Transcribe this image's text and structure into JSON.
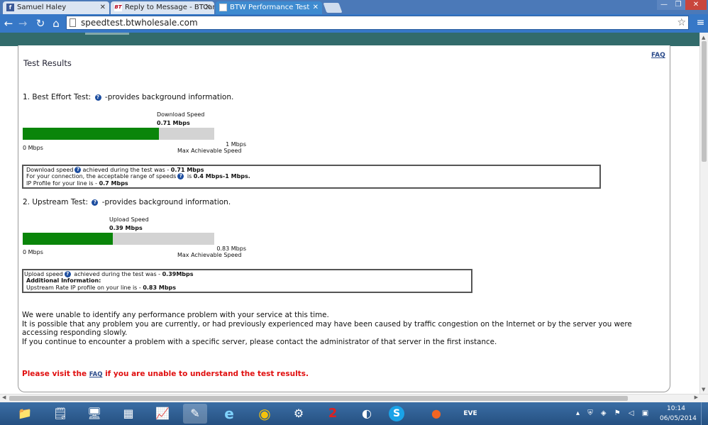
{
  "browser": {
    "tabs": [
      {
        "label": "Samuel Haley",
        "icon": "facebook-icon",
        "favicon_text": "f"
      },
      {
        "label": "Reply to Message - BTCar",
        "icon": "bt-icon",
        "favicon_text": "BT"
      },
      {
        "label": "BTW Performance Test",
        "icon": "page-icon",
        "favicon_text": ""
      }
    ],
    "close_glyph": "✕",
    "url": "speedtest.btwholesale.com",
    "window_controls": {
      "minimize": "—",
      "maximize": "❐",
      "close": "✕"
    }
  },
  "page": {
    "faq_link": "FAQ",
    "title": "Test Results",
    "best_effort": {
      "heading_prefix": "1. Best Effort Test:",
      "heading_suffix": "-provides background information.",
      "speed_label": "Download  Speed",
      "speed_value": "0.71 Mbps",
      "fill_fraction": 0.71,
      "min_label": "0 Mbps",
      "max_value": "1 Mbps",
      "max_label": "Max Achievable Speed",
      "info": {
        "line1_a": "Download speed",
        "line1_b": "achieved during the test was - ",
        "line1_val": "0.71 Mbps",
        "line2_a": "For your connection, the acceptable range of speeds",
        "line2_b": " is ",
        "line2_val": "0.4 Mbps-1 Mbps",
        "line2_end": ".",
        "line3_a": "IP Profile for your line is - ",
        "line3_val": "0.7 Mbps"
      }
    },
    "upstream": {
      "heading_prefix": "2. Upstream Test:",
      "heading_suffix": "-provides background information.",
      "speed_label": "Upload Speed",
      "speed_value": "0.39 Mbps",
      "fill_fraction": 0.47,
      "min_label": "0 Mbps",
      "max_value": "0.83 Mbps",
      "max_label": "Max Achievable Speed",
      "info": {
        "line1_a": "Upload speed",
        "line1_b": " achieved during the test was - ",
        "line1_val": "0.39Mbps",
        "line2": "Additional Information:",
        "line3_a": "Upstream Rate IP profile on your line is - ",
        "line3_val": "0.83 Mbps"
      }
    },
    "message": {
      "line1": "We were unable to identify any performance problem with your service at this time.",
      "line2": "It is possible that any problem you are currently, or had previously experienced may have been caused by traffic congestion on the Internet or by the server you were accessing responding slowly.",
      "line3": "If you continue to encounter a problem with a specific server, please contact the administrator of that server in the first instance."
    },
    "visit": {
      "prefix": "Please visit the ",
      "link": "FAQ",
      "suffix": " if you are unable to understand the test results."
    },
    "colors": {
      "fill": "#0a850a",
      "track": "#d3d3d3",
      "visit_text": "#e01010",
      "strip": "#326b6b"
    }
  },
  "taskbar": {
    "apps": [
      {
        "name": "file-explorer-icon",
        "glyph": "📁"
      },
      {
        "name": "notes-icon",
        "glyph": "🗒"
      },
      {
        "name": "control-panel-icon",
        "glyph": "🖥"
      },
      {
        "name": "calculator-icon",
        "glyph": "▦"
      },
      {
        "name": "monitor-app-icon",
        "glyph": "📈"
      },
      {
        "name": "writer-app-icon",
        "glyph": "✎"
      },
      {
        "name": "internet-explorer-icon",
        "glyph": "e"
      },
      {
        "name": "chrome-icon",
        "glyph": "◉"
      },
      {
        "name": "steam-icon",
        "glyph": "⚙"
      },
      {
        "name": "game-2-icon",
        "glyph": "2"
      },
      {
        "name": "media-player-icon",
        "glyph": "◐"
      },
      {
        "name": "skype-icon",
        "glyph": "S"
      },
      {
        "name": "origin-icon",
        "glyph": "●"
      },
      {
        "name": "eve-icon",
        "glyph": "EVE"
      }
    ],
    "tray_glyphs": "▴ ⛨ ◈ ⚑ ◁ ▣",
    "time": "10:14",
    "date": "06/05/2014"
  }
}
